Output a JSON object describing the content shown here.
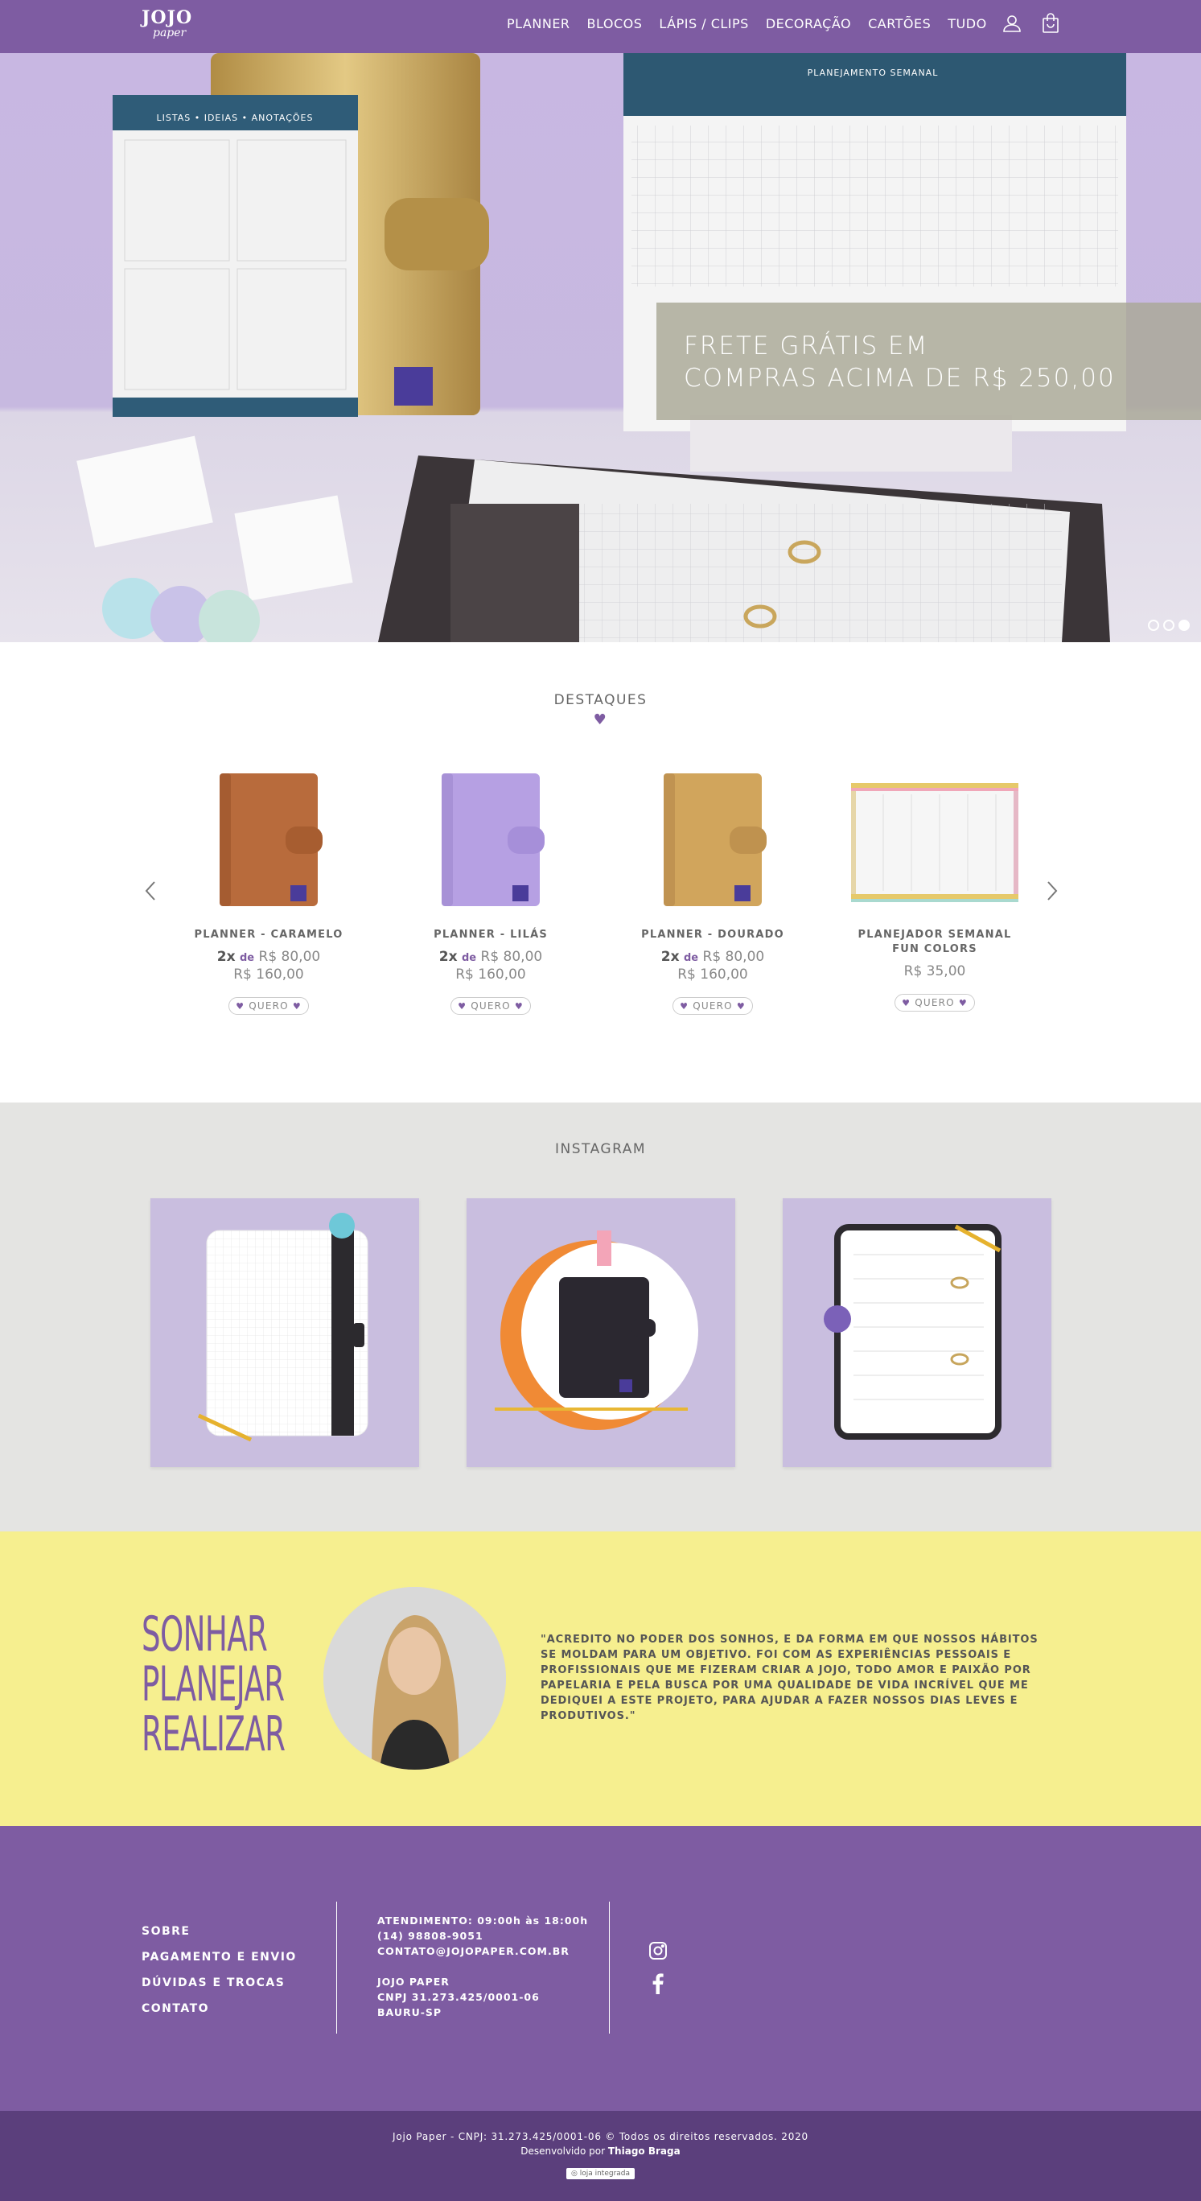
{
  "brand": {
    "logo_top": "JOJO",
    "logo_bottom": "paper"
  },
  "nav": {
    "items": [
      "PLANNER",
      "BLOCOS",
      "LÁPIS / CLIPS",
      "DECORAÇÃO",
      "CARTÕES",
      "TUDO"
    ]
  },
  "hero": {
    "promo_line1": "FRETE GRÁTIS EM",
    "promo_line2": "COMPRAS ACIMA DE R$ 250,00",
    "slides": 3,
    "active_slide": 3,
    "notepad_title": "LISTAS • IDEIAS • ANOTAÇÕES",
    "weekly_title": "PLANEJAMENTO SEMANAL"
  },
  "featured": {
    "title": "DESTAQUES",
    "products": [
      {
        "name": "PLANNER - CARAMELO",
        "installments": "2x",
        "de": "de",
        "inst_value": "R$ 80,00",
        "price": "R$ 160,00",
        "button": "QUERO"
      },
      {
        "name": "PLANNER - LILÁS",
        "installments": "2x",
        "de": "de",
        "inst_value": "R$ 80,00",
        "price": "R$ 160,00",
        "button": "QUERO"
      },
      {
        "name": "PLANNER - DOURADO",
        "installments": "2x",
        "de": "de",
        "inst_value": "R$ 80,00",
        "price": "R$ 160,00",
        "button": "QUERO"
      },
      {
        "name": "PLANEJADOR SEMANAL FUN COLORS",
        "price": "R$ 35,00",
        "button": "QUERO"
      }
    ]
  },
  "instagram": {
    "title": "INSTAGRAM"
  },
  "about": {
    "slogan": [
      "SONHAR",
      "PLANEJAR",
      "REALIZAR"
    ],
    "quote": "\"ACREDITO NO PODER DOS SONHOS, E DA FORMA EM QUE NOSSOS HÁBITOS SE MOLDAM PARA UM OBJETIVO. FOI COM AS EXPERIÊNCIAS PESSOAIS E PROFISSIONAIS QUE ME FIZERAM CRIAR A JOJO, TODO AMOR E PAIXÃO POR PAPELARIA E PELA BUSCA POR UMA QUALIDADE DE VIDA INCRÍVEL QUE ME DEDIQUEI A ESTE PROJETO, PARA AJUDAR A FAZER NOSSOS DIAS LEVES E PRODUTIVOS.\""
  },
  "footer": {
    "links": [
      "SOBRE",
      "PAGAMENTO E ENVIO",
      "DÚVIDAS E TROCAS",
      "CONTATO"
    ],
    "hours": "ATENDIMENTO: 09:00h às 18:00h",
    "phone": "(14) 98808-9051",
    "email": "CONTATO@JOJOPAPER.COM.BR",
    "company": "JOJO PAPER",
    "cnpj": "CNPJ 31.273.425/0001-06",
    "city": "BAURU-SP",
    "copyright": "Jojo Paper - CNPJ: 31.273.425/0001-06 © Todos os direitos reservados. 2020",
    "developed_by": "Desenvolvido por",
    "developer": "Thiago Braga",
    "badge": "loja integrada"
  },
  "colors": {
    "purple": "#7e5ca2",
    "dark_purple": "#5b3f7c",
    "yellow": "#f6ef8f",
    "gray_bg": "#e4e4e2"
  }
}
